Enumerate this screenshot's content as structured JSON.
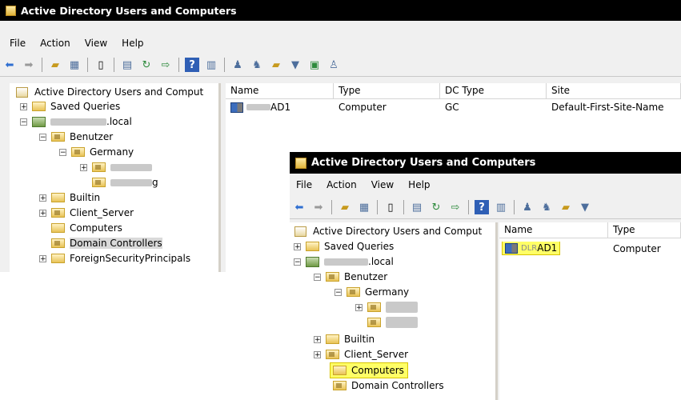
{
  "app_title": "Active Directory Users and Computers",
  "menu": [
    "File",
    "Action",
    "View",
    "Help"
  ],
  "tree": {
    "root": "Active Directory Users and Comput",
    "saved_queries": "Saved Queries",
    "domain_suffix": ".local",
    "benutzer": "Benutzer",
    "germany": "Germany",
    "germany_child2_suffix": "g",
    "builtin": "Builtin",
    "client_server": "Client_Server",
    "computers": "Computers",
    "domain_controllers": "Domain Controllers",
    "foreign": "ForeignSecurityPrincipals"
  },
  "list": {
    "columns": [
      "Name",
      "Type",
      "DC Type",
      "Site"
    ],
    "rows": [
      {
        "name_suffix": "AD1",
        "type": "Computer",
        "dc_type": "GC",
        "site": "Default-First-Site-Name"
      }
    ]
  },
  "overlay_list": {
    "columns": [
      "Name",
      "Type"
    ],
    "rows": [
      {
        "name_suffix": "AD1",
        "name_prefix": "DLR",
        "type": "Computer"
      }
    ]
  },
  "colors": {
    "highlight": "#ffff66",
    "titlebar": "#000000"
  }
}
